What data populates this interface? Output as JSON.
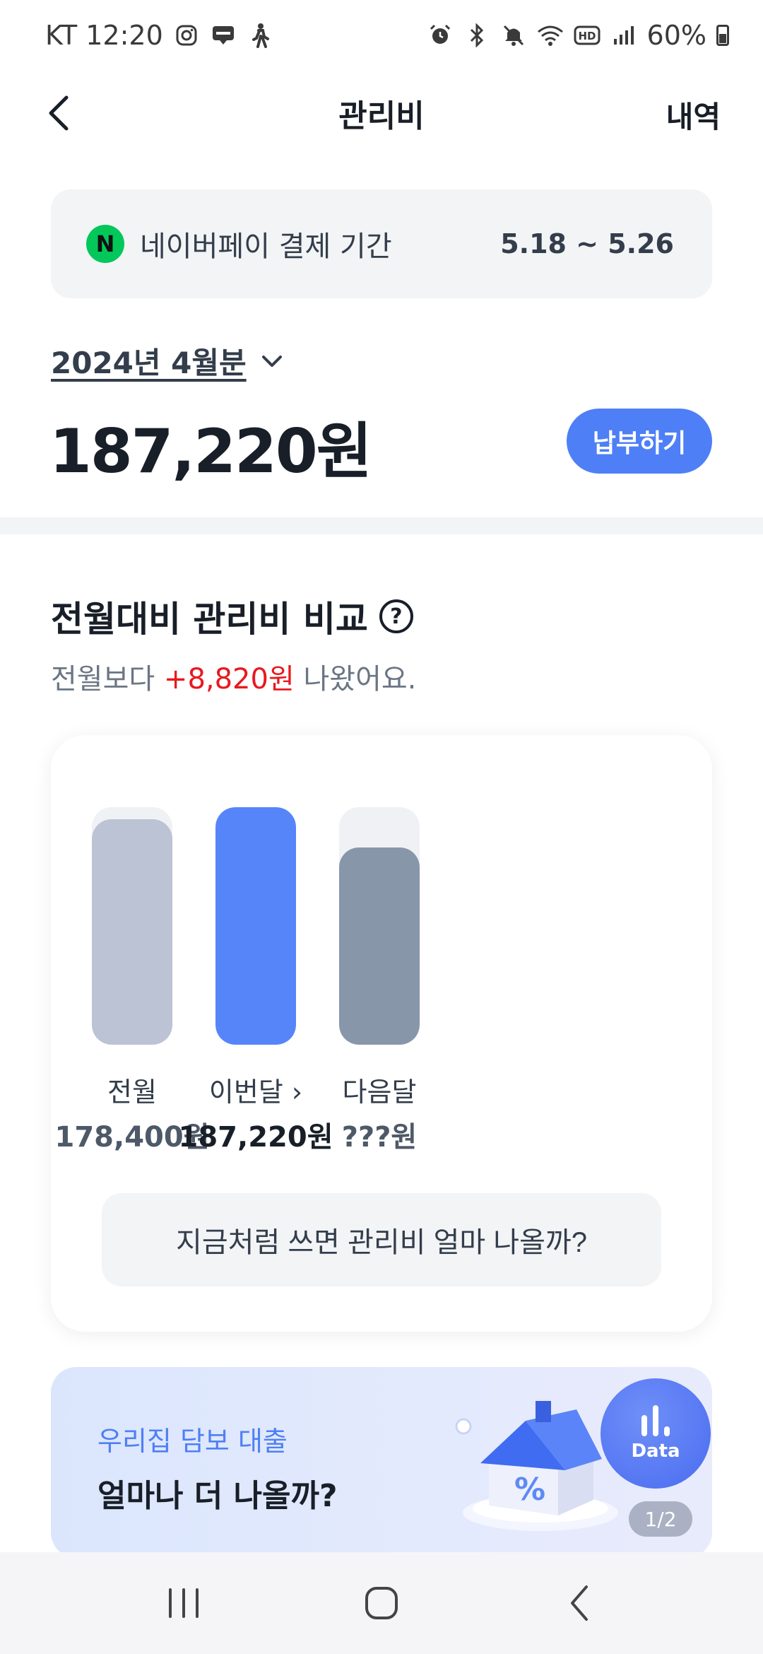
{
  "status_bar": {
    "carrier_time": "KT 12:20",
    "battery_text": "60%",
    "left_icons": [
      "instagram-icon",
      "blog-icon",
      "walking-icon"
    ],
    "right_icons": [
      "alarm-icon",
      "bluetooth-icon",
      "mute-icon",
      "wifi-icon",
      "hd-icon",
      "signal-icon",
      "battery-icon"
    ]
  },
  "header": {
    "title": "관리비",
    "history_label": "내역"
  },
  "pay_banner": {
    "logo_letter": "N",
    "label": "네이버페이 결제 기간",
    "period": "5.18 ~ 5.26"
  },
  "billing": {
    "month_label": "2024년 4월분",
    "amount": "187,220원",
    "pay_button": "납부하기"
  },
  "comparison": {
    "title": "전월대비 관리비 비교",
    "help_symbol": "?",
    "sub_prefix": "전월보다",
    "sub_diff": "+8,820원",
    "sub_suffix": "나왔어요.",
    "predict_button": "지금처럼 쓰면 관리비 얼마 나올까?"
  },
  "chart_data": {
    "type": "bar",
    "categories": [
      "전월",
      "이번달",
      "다음달"
    ],
    "name_labels": [
      "전월",
      "이번달 ›",
      "다음달"
    ],
    "value_labels": [
      "178,400원",
      "187,220원",
      "???원"
    ],
    "values": [
      178400,
      187220,
      null
    ],
    "fill_fraction": [
      0.95,
      1.0,
      0.83
    ],
    "colors": [
      "#bcc3d4",
      "#5685fa",
      "#8896aa"
    ],
    "track_color": "#f0f1f4",
    "title": "",
    "xlabel": "",
    "ylabel": "",
    "grid": false
  },
  "promo": {
    "subtitle": "우리집 담보 대출",
    "title": "얼마나 더 나올까?",
    "badge_label": "Data",
    "page_indicator": "1/2"
  },
  "nav": {
    "buttons": [
      "recent-apps-button",
      "home-button",
      "back-button"
    ]
  }
}
